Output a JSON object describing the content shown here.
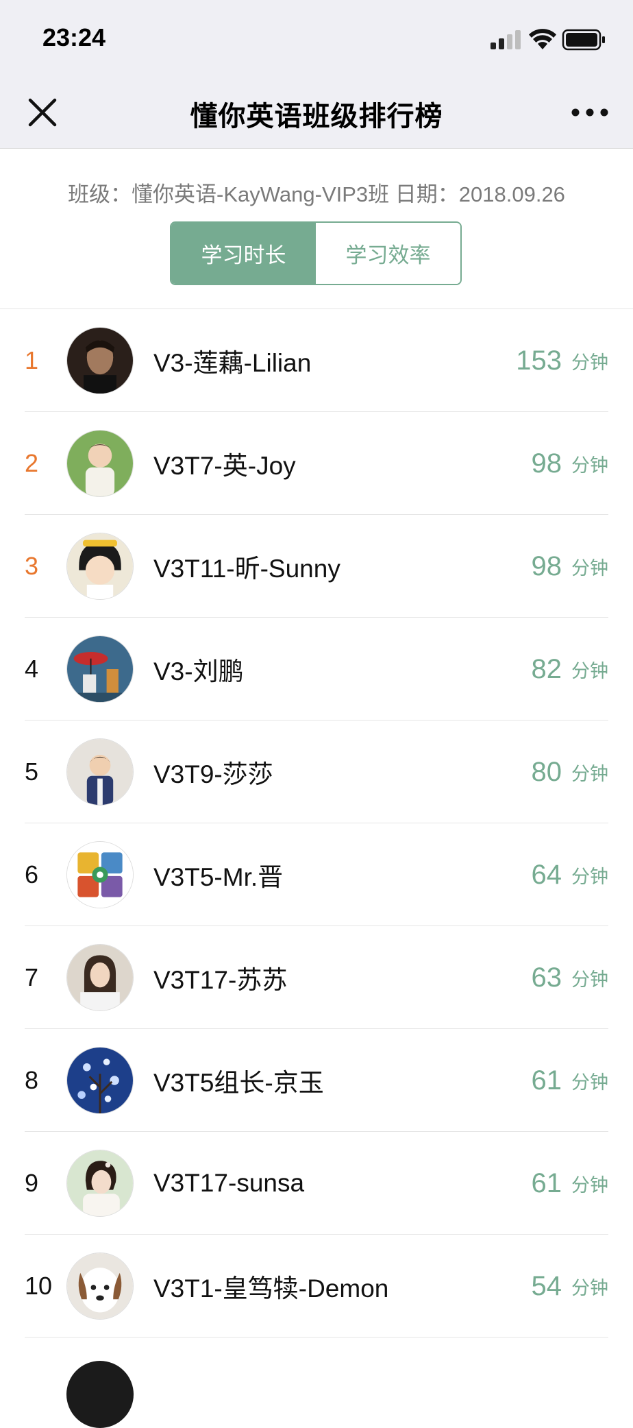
{
  "status_bar": {
    "time": "23:24",
    "icons": [
      "cellular-signal-icon",
      "wifi-icon",
      "battery-icon"
    ]
  },
  "nav": {
    "title": "懂你英语班级排行榜",
    "close_icon": "close-icon",
    "more_icon": "more-icon"
  },
  "header": {
    "class_info": "班级：懂你英语-KayWang-VIP3班 日期：2018.09.26"
  },
  "tabs": [
    {
      "label": "学习时长",
      "active": true
    },
    {
      "label": "学习效率",
      "active": false
    }
  ],
  "colors": {
    "accent": "#76ab91",
    "top_rank": "#e8772e",
    "header_bg": "#efeff4"
  },
  "unit_label": "分钟",
  "rankings": [
    {
      "rank": "1",
      "name": "V3-莲藕-Lilian",
      "minutes": "153"
    },
    {
      "rank": "2",
      "name": "V3T7-英-Joy",
      "minutes": "98"
    },
    {
      "rank": "3",
      "name": "V3T11-昕-Sunny",
      "minutes": "98"
    },
    {
      "rank": "4",
      "name": "V3-刘鹏",
      "minutes": "82"
    },
    {
      "rank": "5",
      "name": "V3T9-莎莎",
      "minutes": "80"
    },
    {
      "rank": "6",
      "name": "V3T5-Mr.晋",
      "minutes": "64"
    },
    {
      "rank": "7",
      "name": "V3T17-苏苏",
      "minutes": "63"
    },
    {
      "rank": "8",
      "name": "V3T5组长-京玉",
      "minutes": "61"
    },
    {
      "rank": "9",
      "name": "V3T17-sunsa",
      "minutes": "61"
    },
    {
      "rank": "10",
      "name": "V3T1-皇笃犊-Demon",
      "minutes": "54"
    }
  ]
}
